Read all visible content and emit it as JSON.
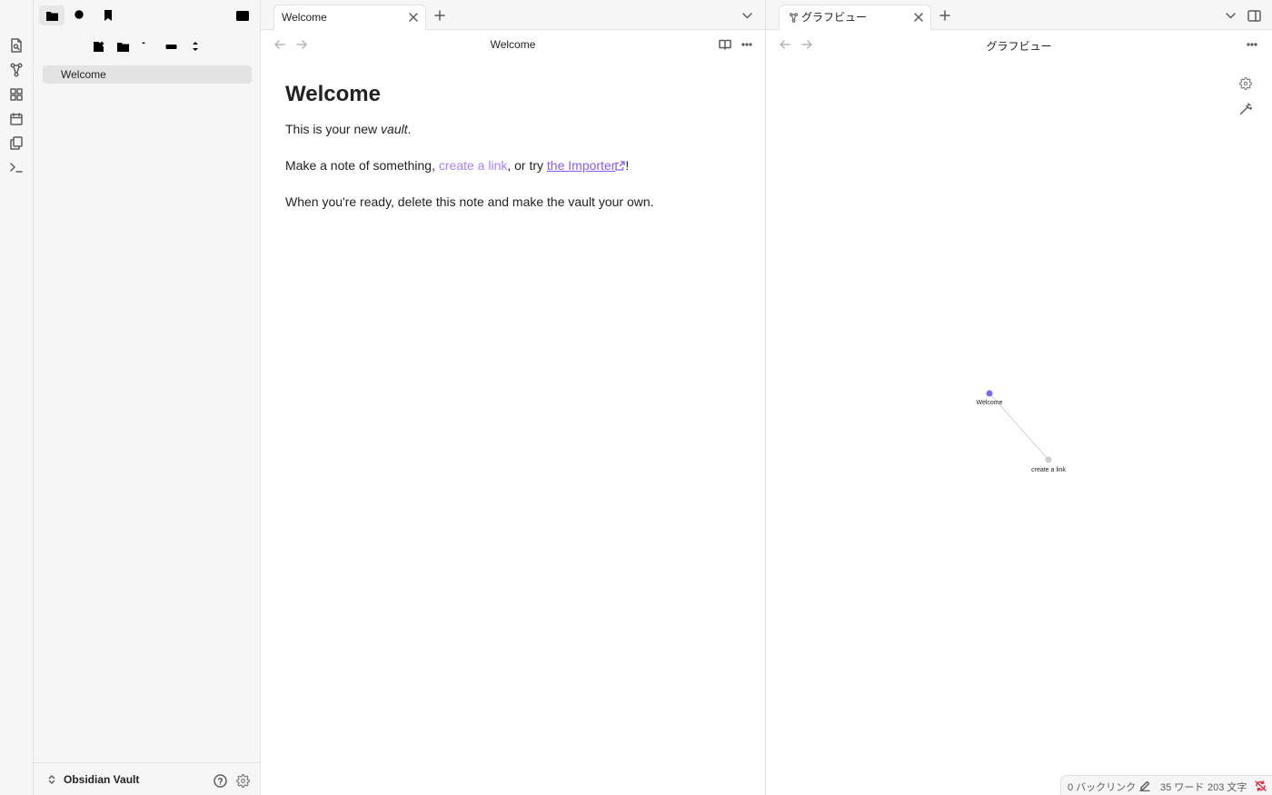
{
  "sidebar": {
    "file_name": "Welcome",
    "vault_name": "Obsidian Vault"
  },
  "left_pane": {
    "tab_label": "Welcome",
    "view_title": "Welcome",
    "note": {
      "heading": "Welcome",
      "p1_prefix": "This is your new ",
      "p1_em": "vault",
      "p1_suffix": ".",
      "p2_prefix": "Make a note of something, ",
      "p2_internal_link": "create a link",
      "p2_middle": ", or try ",
      "p2_external_link": "the Importer",
      "p2_suffix": "!",
      "p3": "When you're ready, delete this note and make the vault your own."
    }
  },
  "right_pane": {
    "tab_label": "グラフビュー",
    "view_title": "グラフビュー",
    "graph": {
      "nodes": [
        {
          "label": "Welcome",
          "color": "#7b6cf6"
        },
        {
          "label": "create a link",
          "color": "#cfcfcf"
        }
      ]
    }
  },
  "status_bar": {
    "backlinks": "0 バックリンク",
    "words": "35 ワード",
    "chars": "203 文字"
  },
  "colors": {
    "accent": "#8a5cf5",
    "internal_link": "#a882ff",
    "sync_error": "#e93147"
  }
}
